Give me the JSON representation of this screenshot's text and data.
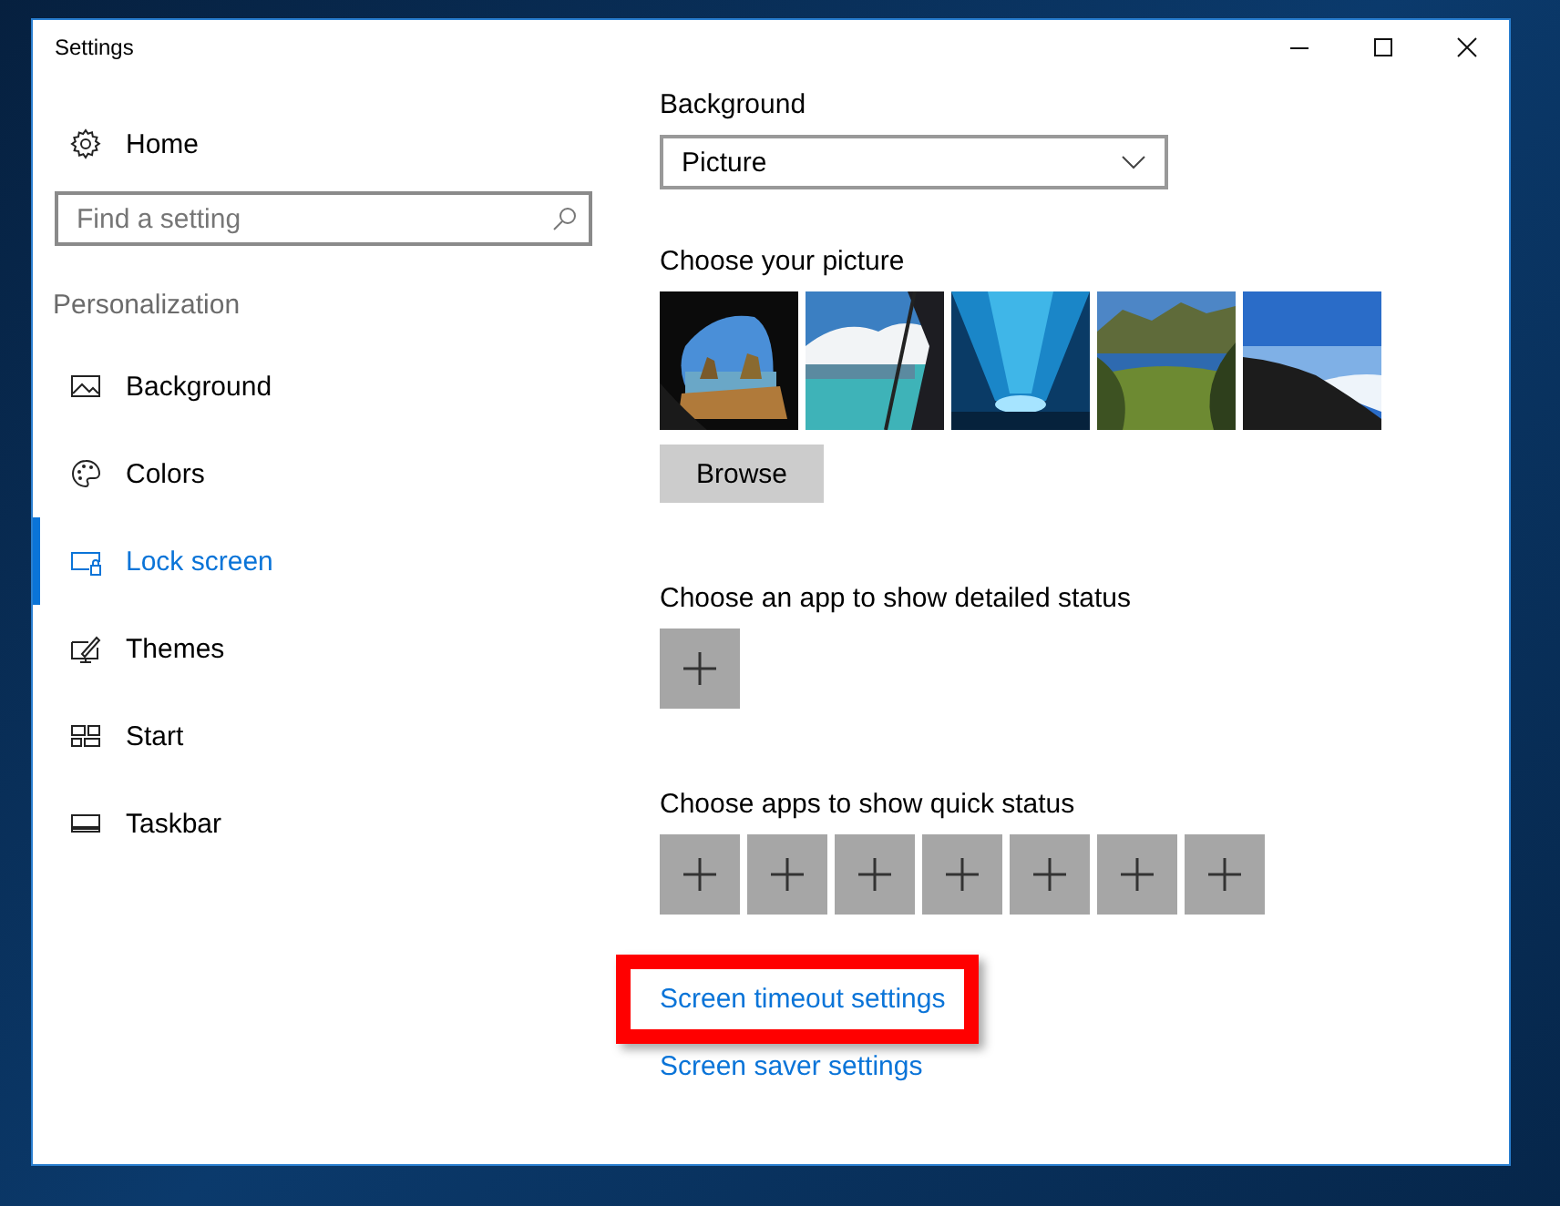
{
  "window": {
    "title": "Settings"
  },
  "sidebar": {
    "home": {
      "label": "Home"
    },
    "search": {
      "placeholder": "Find a setting"
    },
    "section": "Personalization",
    "items": [
      {
        "label": "Background",
        "selected": false
      },
      {
        "label": "Colors",
        "selected": false
      },
      {
        "label": "Lock screen",
        "selected": true
      },
      {
        "label": "Themes",
        "selected": false
      },
      {
        "label": "Start",
        "selected": false
      },
      {
        "label": "Taskbar",
        "selected": false
      }
    ]
  },
  "content": {
    "background_label": "Background",
    "background_dropdown": {
      "value": "Picture"
    },
    "picture_label": "Choose your picture",
    "browse_button": "Browse",
    "detailed_status_label": "Choose an app to show detailed status",
    "detailed_slots": [
      {
        "kind": "add"
      }
    ],
    "quick_status_label": "Choose apps to show quick status",
    "quick_slots": [
      {
        "kind": "add"
      },
      {
        "kind": "add"
      },
      {
        "kind": "add"
      },
      {
        "kind": "add"
      },
      {
        "kind": "add"
      },
      {
        "kind": "add"
      },
      {
        "kind": "add"
      }
    ],
    "links": [
      {
        "label": "Screen timeout settings",
        "highlighted": true
      },
      {
        "label": "Screen saver settings",
        "highlighted": false
      }
    ]
  }
}
